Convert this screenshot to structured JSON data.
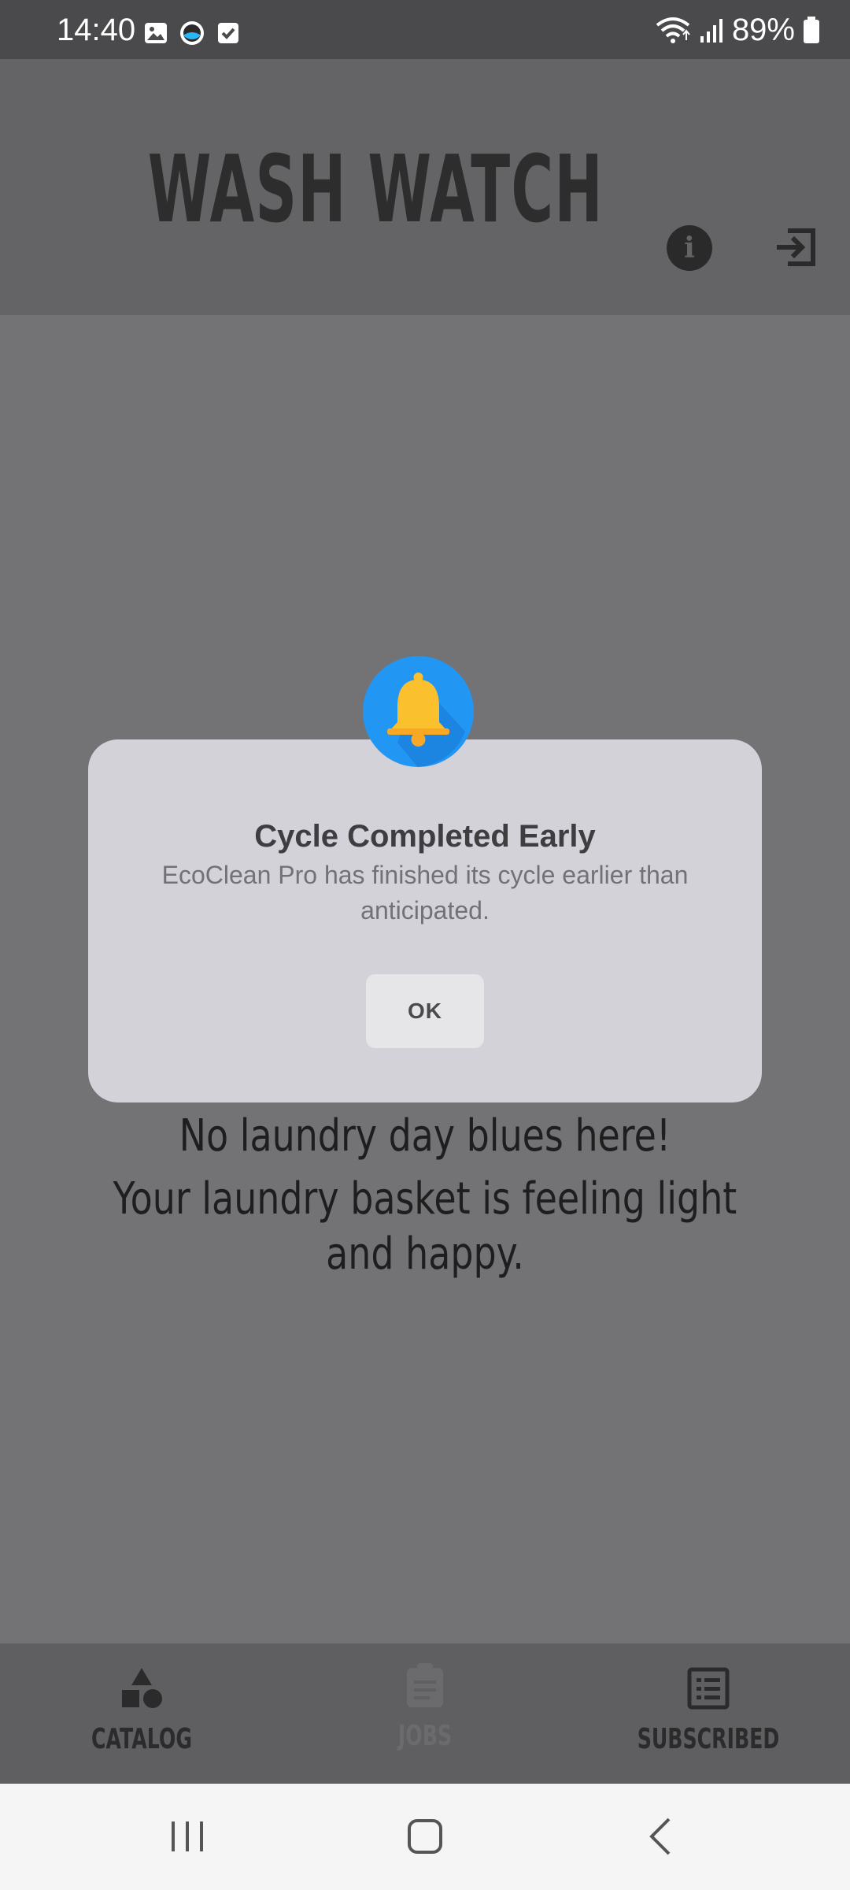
{
  "status_bar": {
    "time": "14:40",
    "battery": "89%",
    "icons": [
      "image-icon",
      "app-icon",
      "check-icon",
      "wifi-icon",
      "signal-icon",
      "battery-icon"
    ]
  },
  "header": {
    "title": "WASH WATCH",
    "info_icon": "info-icon",
    "logout_icon": "logout-icon"
  },
  "empty_state": {
    "line1": "No laundry day blues here!",
    "line2": "Your laundry basket is feeling light and happy."
  },
  "dialog": {
    "icon": "bell-icon",
    "title": "Cycle Completed Early",
    "message": "EcoClean Pro has finished its cycle earlier than anticipated.",
    "ok_label": "OK"
  },
  "bottom_nav": {
    "items": [
      {
        "label": "CATALOG",
        "icon": "shapes-icon"
      },
      {
        "label": "JOBS",
        "icon": "clipboard-icon"
      },
      {
        "label": "SUBSCRIBED",
        "icon": "list-icon"
      }
    ]
  },
  "colors": {
    "dialog_bg": "#d3d2d9",
    "bell_circle": "#2196f3",
    "bell": "#fbc02d",
    "overlay_bg": "#737275"
  }
}
